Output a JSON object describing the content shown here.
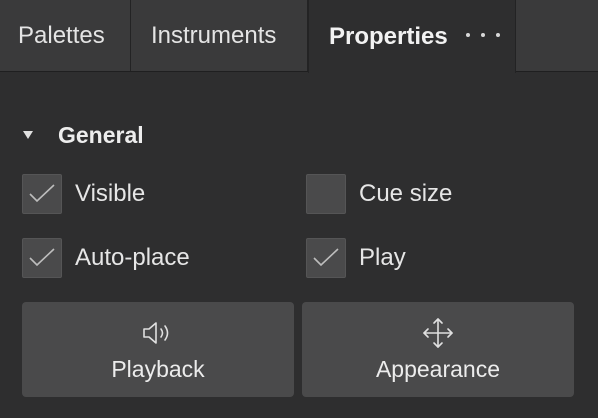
{
  "tabs": [
    {
      "label": "Palettes"
    },
    {
      "label": "Instruments"
    },
    {
      "label": "Properties",
      "active": true
    }
  ],
  "tabs_more_icon": "more-horizontal-icon",
  "section": {
    "title": "General",
    "expanded": true
  },
  "checkboxes": {
    "visible": {
      "label": "Visible",
      "checked": true
    },
    "cue_size": {
      "label": "Cue size",
      "checked": false
    },
    "auto_place": {
      "label": "Auto-place",
      "checked": true
    },
    "play": {
      "label": "Play",
      "checked": true
    }
  },
  "buttons": {
    "playback": {
      "label": "Playback",
      "icon": "speaker-icon"
    },
    "appearance": {
      "label": "Appearance",
      "icon": "move-arrows-icon"
    }
  }
}
